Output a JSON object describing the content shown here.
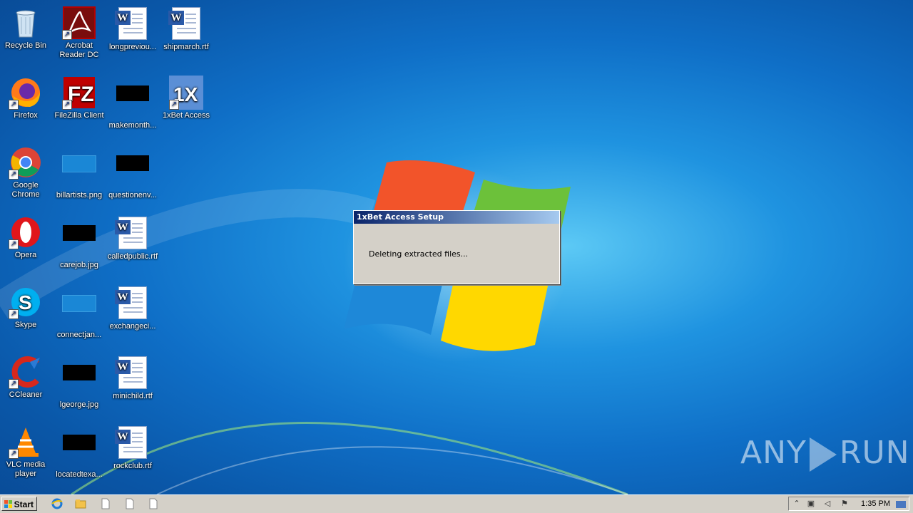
{
  "desktop": {
    "icons": [
      {
        "label": "Recycle Bin",
        "type": "recycle"
      },
      {
        "label": "Acrobat Reader DC",
        "label2": "Reader DC",
        "label1": "Acrobat",
        "type": "acrobat"
      },
      {
        "label": "longpreviou...",
        "type": "word"
      },
      {
        "label": "shipmarch.rtf",
        "type": "word"
      },
      {
        "label": "Firefox",
        "type": "firefox"
      },
      {
        "label": "FileZilla Client",
        "type": "filezilla"
      },
      {
        "label": "makemonth...",
        "type": "black"
      },
      {
        "label": "1xBet Access",
        "type": "onexbet"
      },
      {
        "label": "Google Chrome",
        "label1": "Google",
        "label2": "Chrome",
        "type": "chrome"
      },
      {
        "label": "billartists.png",
        "type": "blue"
      },
      {
        "label": "questionenv...",
        "type": "black"
      },
      {
        "label": "Opera",
        "type": "opera"
      },
      {
        "label": "carejob.jpg",
        "type": "black"
      },
      {
        "label": "calledpublic.rtf",
        "type": "word"
      },
      {
        "label": "Skype",
        "type": "skype"
      },
      {
        "label": "connectjan...",
        "type": "blue"
      },
      {
        "label": "exchangeci...",
        "type": "word"
      },
      {
        "label": "CCleaner",
        "type": "ccleaner"
      },
      {
        "label": "lgeorge.jpg",
        "type": "black"
      },
      {
        "label": "minichild.rtf",
        "type": "word"
      },
      {
        "label": "VLC media player",
        "label1": "VLC media",
        "label2": "player",
        "type": "vlc"
      },
      {
        "label": "locatedtexa...",
        "type": "black"
      },
      {
        "label": "rockclub.rtf",
        "type": "word"
      }
    ]
  },
  "dialog": {
    "title": "1xBet Access Setup",
    "message": "Deleting extracted files..."
  },
  "watermark": {
    "left": "ANY",
    "right": "RUN"
  },
  "taskbar": {
    "start_label": "Start",
    "clock": "1:35 PM"
  },
  "colors": {
    "dialog_title_start": "#0a246a",
    "dialog_title_end": "#a6caf0",
    "dialog_bg": "#d4d0c8"
  }
}
